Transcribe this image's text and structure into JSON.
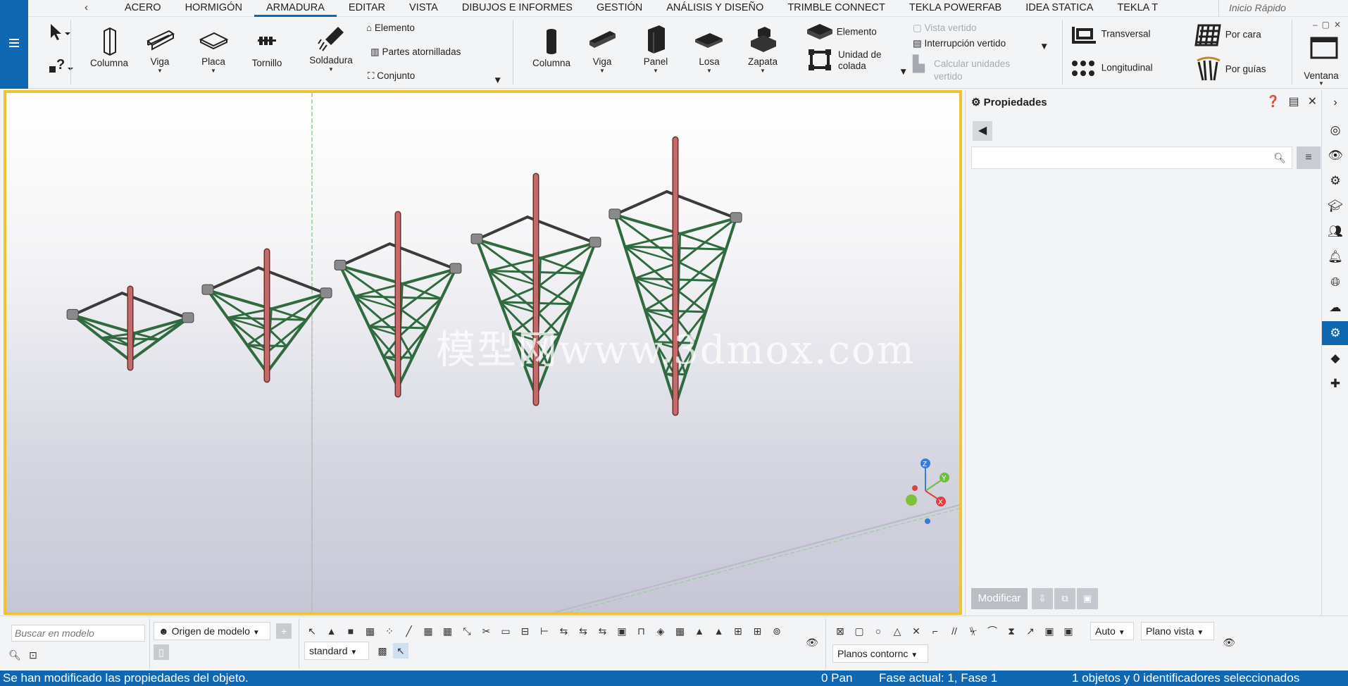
{
  "tabs": [
    "ACERO",
    "HORMIGÓN",
    "ARMADURA",
    "EDITAR",
    "VISTA",
    "DIBUJOS E INFORMES",
    "GESTIÓN",
    "ANÁLISIS Y DISEÑO",
    "TRIMBLE CONNECT",
    "TEKLA POWERFAB",
    "IDEA STATICA",
    "TEKLA T"
  ],
  "active_tab": "ARMADURA",
  "quick_search_placeholder": "Inicio Rápido",
  "ribbon": {
    "steel": {
      "columna": "Columna",
      "viga": "Viga",
      "placa": "Placa",
      "tornillo": "Tornillo",
      "soldadura": "Soldadura",
      "elemento": "Elemento",
      "partes_atornilladas": "Partes atornilladas",
      "conjunto": "Conjunto"
    },
    "concrete": {
      "columna": "Columna",
      "viga": "Viga",
      "panel": "Panel",
      "losa": "Losa",
      "zapata": "Zapata",
      "elemento": "Elemento",
      "unidad_colada_1": "Unidad de",
      "unidad_colada_2": "colada",
      "vista_vertido": "Vista vertido",
      "interrupcion_vertido": "Interrupción vertido",
      "calcular_1": "Calcular unidades",
      "calcular_2": "vertido"
    },
    "rebar": {
      "transversal": "Transversal",
      "longitudinal": "Longitudinal",
      "por_cara": "Por cara",
      "por_guias": "Por guías"
    },
    "ventana": "Ventana"
  },
  "viewport": {
    "watermark": "模型网www.3dmox.com",
    "axis_labels": {
      "z": "Z",
      "y": "Y",
      "x": "X"
    }
  },
  "properties": {
    "title": "Propiedades",
    "modify_button": "Modificar"
  },
  "bottom": {
    "search_placeholder": "Buscar en modelo",
    "origin_dropdown": "Origen de modelo",
    "standard_dropdown": "standard",
    "auto_dropdown": "Auto",
    "plano_vista_dropdown": "Plano vista",
    "planos_contorno_dropdown": "Planos contornc"
  },
  "status": {
    "message": "Se han modificado las propiedades del objeto.",
    "pan": "0  Pan",
    "phase": "Fase actual: 1, Fase 1",
    "selection": "1 objetos y 0 identificadores seleccionados"
  },
  "colors": {
    "accent": "#0f67b1",
    "viewport_border": "#f2c230",
    "truss_green": "#2f6b3e",
    "column_red": "#c46a6a",
    "top_frame": "#3b3b3b"
  }
}
